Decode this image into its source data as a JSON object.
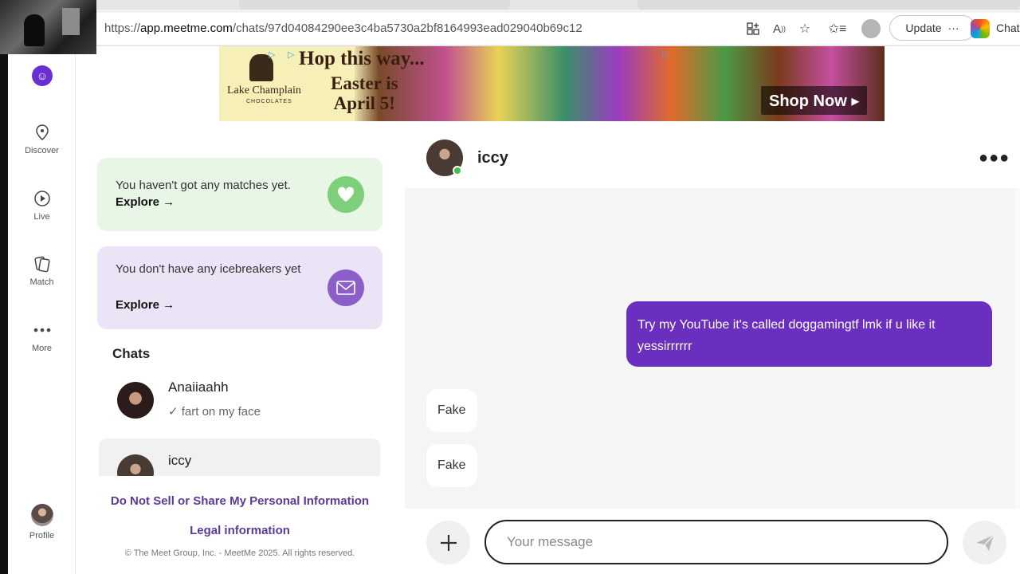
{
  "browser": {
    "url_scheme": "https://",
    "url_host": "app.meetme.com",
    "url_path": "/chats/97d04084290ee3c4ba5730a2bf8164993ead029040b69c12",
    "update_label": "Update",
    "chat_label": "Chat"
  },
  "rail": {
    "items": [
      {
        "label": "Discover",
        "icon": "location-pin-icon"
      },
      {
        "label": "Live",
        "icon": "play-circle-icon"
      },
      {
        "label": "Match",
        "icon": "cards-icon"
      },
      {
        "label": "More",
        "icon": "more-dots-icon"
      },
      {
        "label": "Profile",
        "icon": "avatar"
      }
    ]
  },
  "ad": {
    "brand": "Lake Champlain",
    "brand_sub": "CHOCOLATES",
    "headline": "Hop this way...",
    "subline_1": "Easter is",
    "subline_2": "April 5!",
    "cta": "Shop Now ▸"
  },
  "matches_card": {
    "text": "You haven't got any matches yet.",
    "link": "Explore →"
  },
  "icebreakers_card": {
    "text": "You don't have any icebreakers yet",
    "link": "Explore →"
  },
  "chats": {
    "title": "Chats",
    "items": [
      {
        "name": "Anaiiaahh",
        "preview": "✓ fart on my face"
      },
      {
        "name": "iccy",
        "preview": ""
      }
    ]
  },
  "footer": {
    "privacy_link": "Do Not Sell or Share My Personal Information",
    "legal_link": "Legal information",
    "copyright": "© The Meet Group, Inc. - MeetMe 2025. All rights reserved."
  },
  "conversation": {
    "name": "iccy",
    "messages": [
      {
        "direction": "out",
        "text": "Try my YouTube it's called doggamingtf lmk if u like it yessirrrrrr"
      },
      {
        "direction": "in",
        "text": "Fake"
      },
      {
        "direction": "in",
        "text": "Fake"
      }
    ]
  },
  "composer": {
    "placeholder": "Your message"
  },
  "colors": {
    "brand_purple": "#6b2fbf",
    "match_green": "#7dcf7a",
    "icebreaker_purple": "#8a5fc8"
  }
}
